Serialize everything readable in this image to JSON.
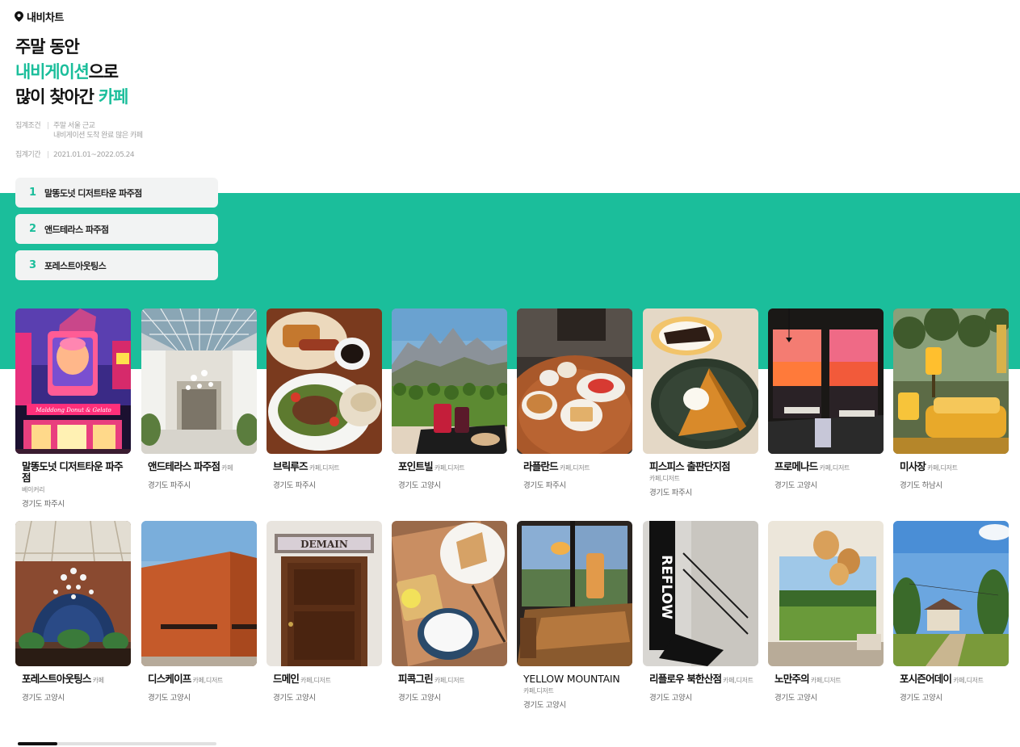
{
  "brand": {
    "name": "내비차트",
    "icon": "map-pin-icon"
  },
  "headline": {
    "line1": "주말 동안",
    "line2_highlight": "내비게이션",
    "line2_rest": "으로",
    "line3_rest": "많이 찾아간 ",
    "line3_highlight": "카페"
  },
  "conditions": {
    "label": "집계조건",
    "value1": "주말 서울 근교",
    "value2": "내비게이션 도착 완료 많은 카페",
    "period_label": "집계기간",
    "period_value": "2021.01.01~2022.05.24"
  },
  "ranking": [
    {
      "rank": "1",
      "name": "말똥도넛 디저트타운 파주점"
    },
    {
      "rank": "2",
      "name": "앤드테라스 파주점"
    },
    {
      "rank": "3",
      "name": "포레스트아웃팅스"
    }
  ],
  "cafes": [
    {
      "title": "말똥도넛 디저트타운 파주점",
      "category": "베이커리",
      "location": "경기도 파주시"
    },
    {
      "title": "앤드테라스 파주점",
      "category": "카페",
      "location": "경기도 파주시"
    },
    {
      "title": "브릭루즈",
      "category": "카페,디저트",
      "location": "경기도 파주시"
    },
    {
      "title": "포인트빌",
      "category": "카페,디저트",
      "location": "경기도 고양시"
    },
    {
      "title": "라플란드",
      "category": "카페,디저트",
      "location": "경기도 파주시"
    },
    {
      "title": "피스피스 출판단지점",
      "category": "카페,디저트",
      "location": "경기도 파주시"
    },
    {
      "title": "프로메나드",
      "category": "카페,디저트",
      "location": "경기도 고양시"
    },
    {
      "title": "미사장",
      "category": "카페,디저트",
      "location": "경기도 하남시"
    },
    {
      "title": "포레스트아웃팅스",
      "category": "카페",
      "location": "경기도 고양시"
    },
    {
      "title": "디스케이프",
      "category": "카페,디저트",
      "location": "경기도 고양시"
    },
    {
      "title": "드메인",
      "category": "카페,디저트",
      "location": "경기도 고양시"
    },
    {
      "title": "피콕그린",
      "category": "카페,디저트",
      "location": "경기도 고양시"
    },
    {
      "title": "YELLOW MOUNTAIN",
      "category": "카페,디저트",
      "location": "경기도 고양시"
    },
    {
      "title": "리플로우 북한산점",
      "category": "카페,디저트",
      "location": "경기도 고양시"
    },
    {
      "title": "노만주의",
      "category": "카페,디저트",
      "location": "경기도 고양시"
    },
    {
      "title": "포시즌어데이",
      "category": "카페,디저트",
      "location": "경기도 고양시"
    }
  ],
  "photo_text": {
    "demain_sign": "DEMAIN",
    "reflow_sign": "REFLOW",
    "donut_sign": "Malddong Donut & Gelato"
  },
  "scroll": {
    "progress": 0.2
  },
  "colors": {
    "accent": "#1bbe9b",
    "rank_bg": "#f2f3f3"
  }
}
